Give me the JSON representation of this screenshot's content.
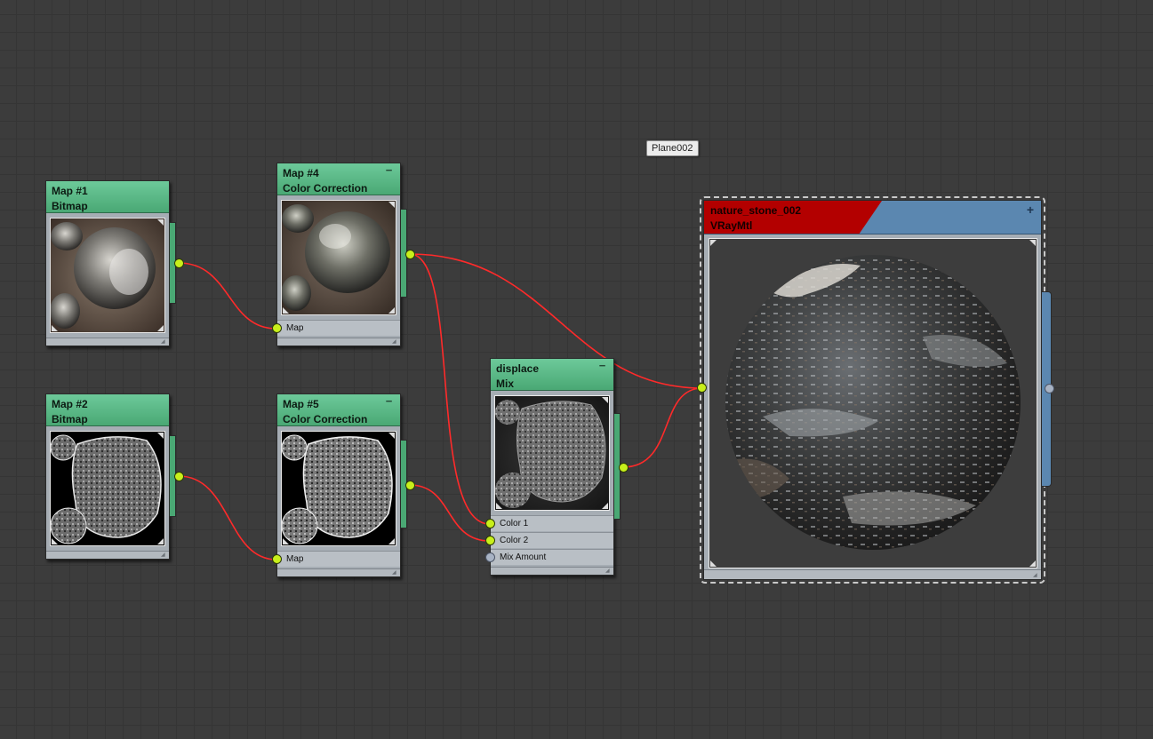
{
  "canvas": {
    "object_label": "Plane002"
  },
  "nodes": {
    "map1": {
      "name": "Map #1",
      "type": "Bitmap"
    },
    "map2": {
      "name": "Map #2",
      "type": "Bitmap"
    },
    "map4": {
      "name": "Map #4",
      "type": "Color Correction",
      "inputs": [
        "Map"
      ]
    },
    "map5": {
      "name": "Map #5",
      "type": "Color Correction",
      "inputs": [
        "Map"
      ]
    },
    "mix": {
      "name": "displace",
      "type": "Mix",
      "inputs": [
        "Color 1",
        "Color 2",
        "Mix Amount"
      ]
    },
    "material": {
      "name": "nature_stone_002",
      "type": "VRayMtl"
    }
  },
  "icons": {
    "collapse": "−",
    "expand": "+",
    "grip": "◢"
  },
  "colors": {
    "wire": "#ff2a2a",
    "socket": "#c8ef1b",
    "map_header": "#4aa874",
    "material_header_red": "#b30000",
    "material_header_blue": "#5b87b0"
  }
}
